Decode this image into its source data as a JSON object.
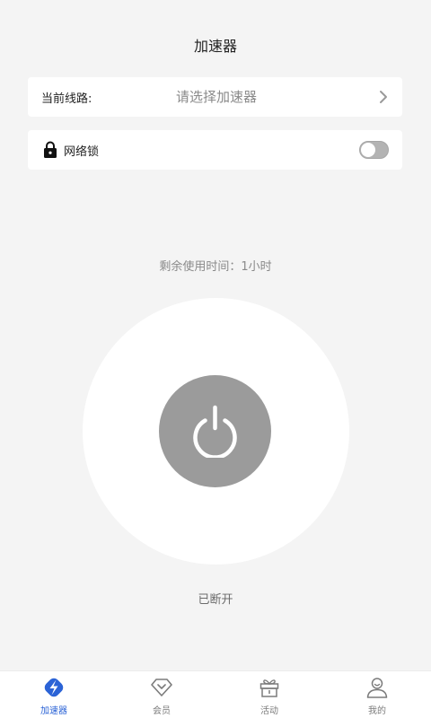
{
  "page": {
    "title": "加速器"
  },
  "line": {
    "label": "当前线路:",
    "placeholder": "请选择加速器"
  },
  "network_lock": {
    "label": "网络锁",
    "enabled": false
  },
  "remaining_time": "剩余使用时间：1小时",
  "connection_status": "已断开",
  "tabs": [
    {
      "label": "加速器",
      "icon": "lightning-icon",
      "active": true
    },
    {
      "label": "会员",
      "icon": "vip-diamond-icon",
      "active": false
    },
    {
      "label": "活动",
      "icon": "gift-icon",
      "active": false
    },
    {
      "label": "我的",
      "icon": "user-icon",
      "active": false
    }
  ],
  "colors": {
    "background": "#f4f4f4",
    "accent": "#2b63d6",
    "power_button": "#9b9b9b"
  }
}
